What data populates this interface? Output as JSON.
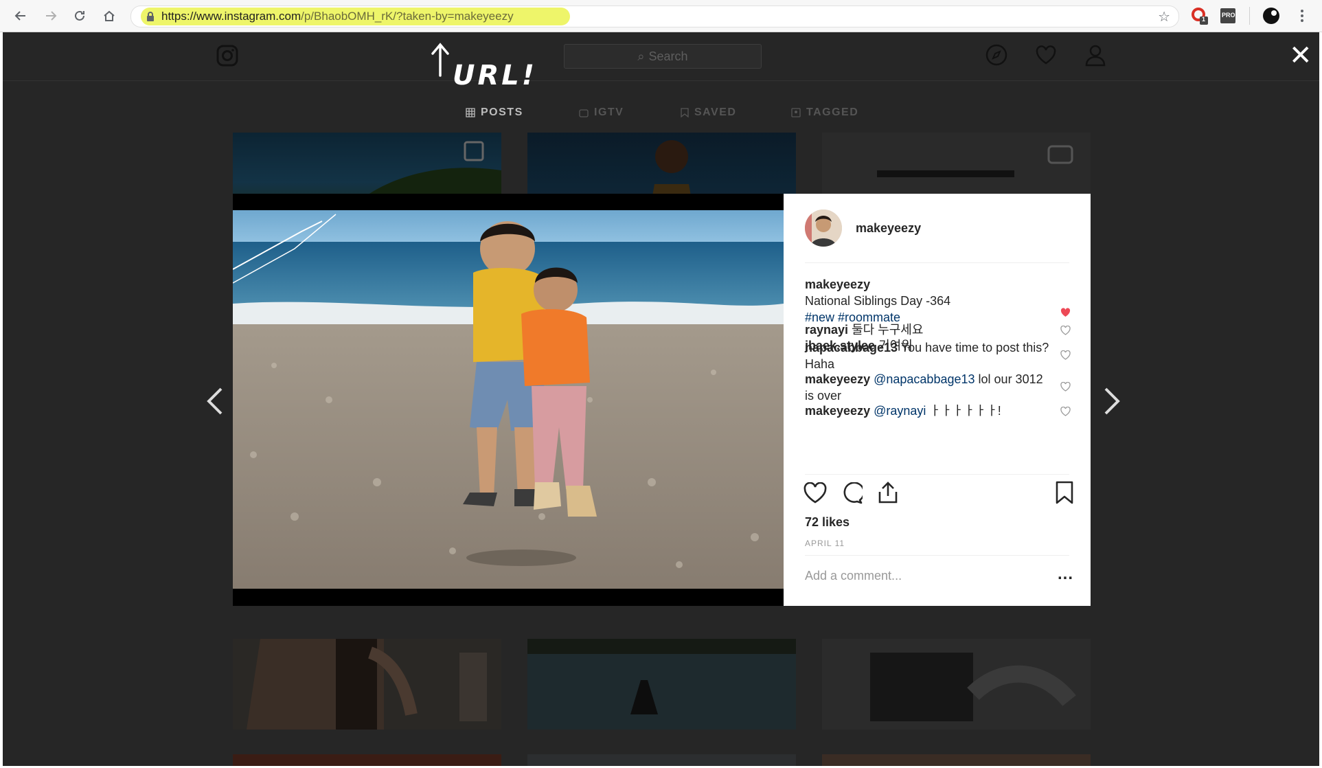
{
  "browser": {
    "url_domain": "https://www.instagram.com",
    "url_path": "/p/BhaobOMH_rK/?taken-by=makeyeezy",
    "extension_badge": "1",
    "extension_label": "PRO",
    "icons": [
      "back-arrow-icon",
      "forward-arrow-icon",
      "reload-icon",
      "home-icon",
      "lock-icon",
      "star-icon",
      "kebab-menu-icon"
    ]
  },
  "header": {
    "search_placeholder": "Search",
    "annotation": "URL!"
  },
  "tabs": [
    {
      "label": "POSTS",
      "active": true
    },
    {
      "label": "IGTV",
      "active": false
    },
    {
      "label": "SAVED",
      "active": false
    },
    {
      "label": "TAGGED",
      "active": false
    }
  ],
  "post": {
    "author": "makeyeezy",
    "caption": {
      "user": "makeyeezy",
      "text": "National Siblings Day -364",
      "hashtags": "#new #roommate"
    },
    "comments": [
      {
        "user": "jbaek.stylee",
        "text": "기여워",
        "mention": "",
        "liked": true
      },
      {
        "user": "raynayi",
        "text": "둘다 누구세요",
        "mention": "",
        "liked": false
      },
      {
        "user": "napacabbage13",
        "text": "You have time to post this? Haha",
        "mention": "",
        "liked": false
      },
      {
        "user": "makeyeezy",
        "mention": "@napacabbage13",
        "text": "lol our 3012 is over",
        "liked": false
      },
      {
        "user": "makeyeezy",
        "mention": "@raynayi",
        "text": "ㅏㅏㅏㅏㅏㅏ!",
        "liked": false
      }
    ],
    "likes": "72 likes",
    "date": "APRIL 11",
    "comment_placeholder": "Add a comment...",
    "more": "...",
    "like_color": "#ed4956"
  }
}
